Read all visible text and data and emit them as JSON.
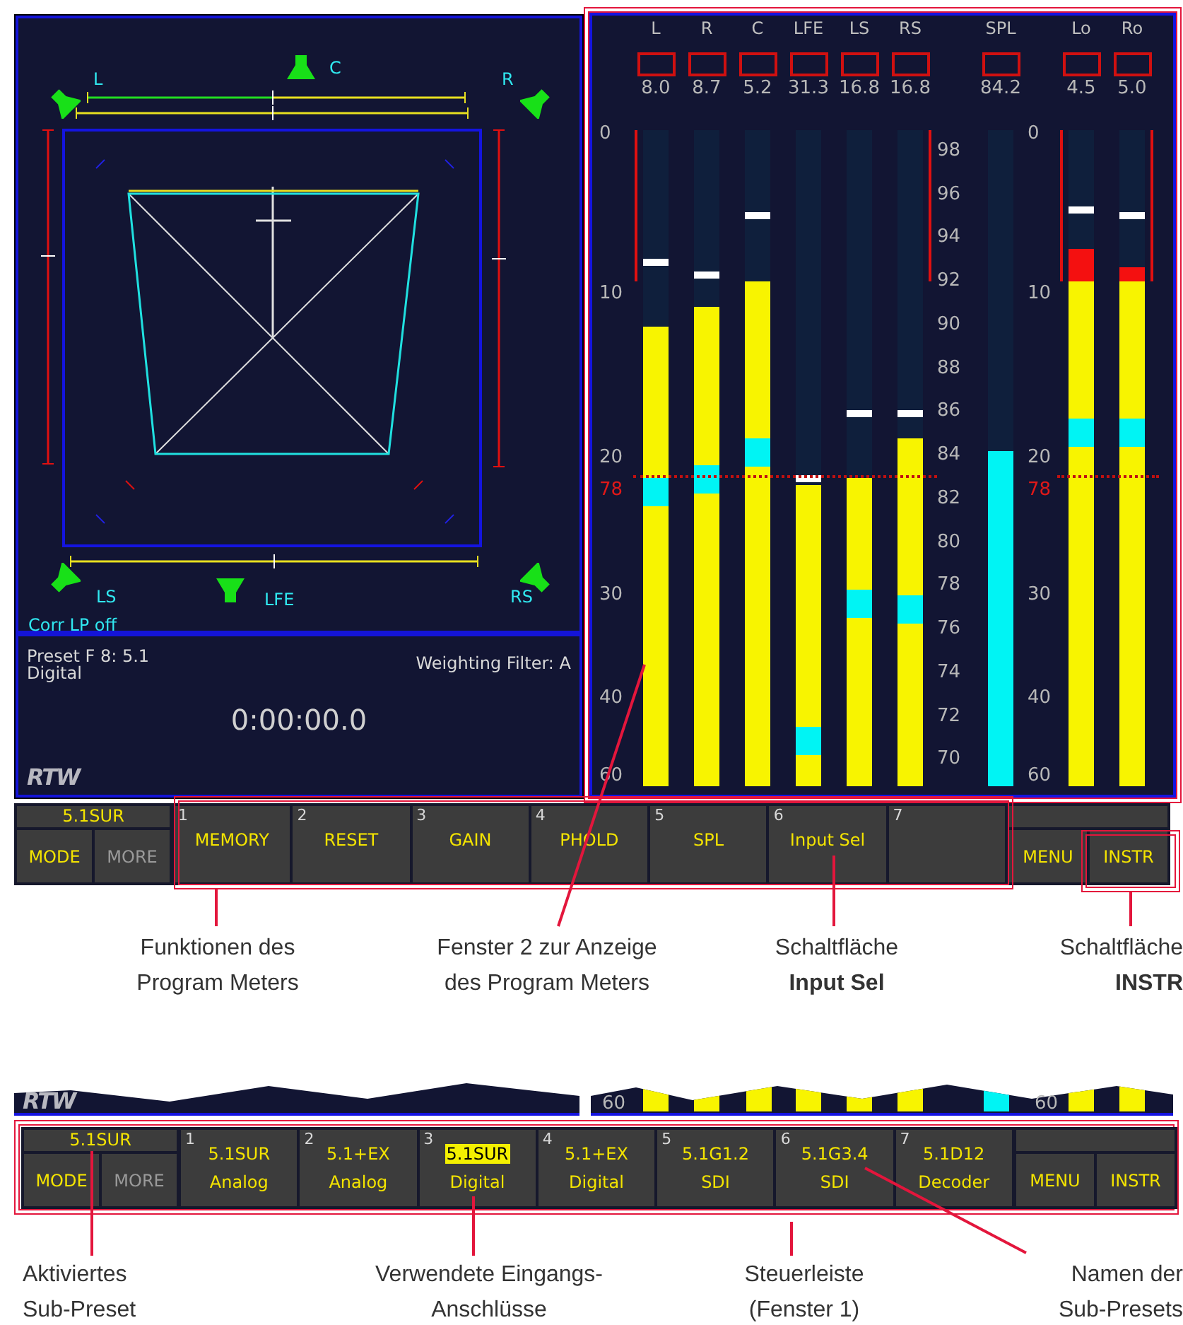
{
  "surround_display": {
    "speakers": [
      {
        "label": "L"
      },
      {
        "label": "C"
      },
      {
        "label": "R"
      },
      {
        "label": "LS"
      },
      {
        "label": "LFE"
      },
      {
        "label": "RS"
      }
    ],
    "status": "Corr LP off"
  },
  "info_panel": {
    "preset": "Preset F 8: 5.1",
    "input": "Digital",
    "weighting": "Weighting Filter: A",
    "timer": "0:00:00.0",
    "logo": "RTW"
  },
  "meters": {
    "left_scale": [
      {
        "label": "0",
        "kind": "tick"
      },
      {
        "label": "10",
        "kind": "tick"
      },
      {
        "label": "20",
        "kind": "tick"
      },
      {
        "label": "78",
        "kind": "ref"
      },
      {
        "label": "30",
        "kind": "tick"
      },
      {
        "label": "40",
        "kind": "tick"
      },
      {
        "label": "60",
        "kind": "tick"
      }
    ],
    "spl_scale": [
      {
        "label": "98"
      },
      {
        "label": "96"
      },
      {
        "label": "94"
      },
      {
        "label": "92"
      },
      {
        "label": "90"
      },
      {
        "label": "88"
      },
      {
        "label": "86"
      },
      {
        "label": "84"
      },
      {
        "label": "82"
      },
      {
        "label": "80"
      },
      {
        "label": "78"
      },
      {
        "label": "76"
      },
      {
        "label": "74"
      },
      {
        "label": "72"
      },
      {
        "label": "70"
      }
    ],
    "right_scale": [
      {
        "label": "0",
        "kind": "tick"
      },
      {
        "label": "10",
        "kind": "tick"
      },
      {
        "label": "20",
        "kind": "tick"
      },
      {
        "label": "78",
        "kind": "ref"
      },
      {
        "label": "30",
        "kind": "tick"
      },
      {
        "label": "40",
        "kind": "tick"
      },
      {
        "label": "60",
        "kind": "tick"
      }
    ],
    "channels": [
      {
        "kind": "channel",
        "label": "L",
        "reading": "8.0",
        "level": 0.7,
        "peak": {
          "level": 0.8
        },
        "marker": {
          "level": 0.47
        },
        "left_bracket": true
      },
      {
        "kind": "channel",
        "label": "R",
        "reading": "8.7",
        "level": 0.73,
        "peak": {
          "level": 0.78
        },
        "marker": {
          "level": 0.49
        }
      },
      {
        "kind": "channel",
        "label": "C",
        "reading": "5.2",
        "level": 0.77,
        "peak": {
          "level": 0.87
        },
        "marker": {
          "level": 0.53
        }
      },
      {
        "kind": "channel",
        "label": "LFE",
        "reading": "31.3",
        "level": 0.46,
        "peak": {
          "level": 0.47
        },
        "marker": {
          "level": 0.09
        }
      },
      {
        "kind": "channel",
        "label": "LS",
        "reading": "16.8",
        "level": 0.47,
        "peak": {
          "level": 0.57
        },
        "marker": {
          "level": 0.3
        }
      },
      {
        "kind": "channel",
        "label": "RS",
        "reading": "16.8",
        "level": 0.53,
        "peak": {
          "level": 0.57
        },
        "marker": {
          "level": 0.29
        },
        "right_bracket": true
      },
      {
        "kind": "spl",
        "label": "SPL",
        "reading": "84.2",
        "level": 0.51
      },
      {
        "kind": "channel",
        "label": "Lo",
        "reading": "4.5",
        "level": 0.77,
        "over": {
          "level": 0.82
        },
        "peak": {
          "level": 0.88
        },
        "marker": {
          "level": 0.56
        },
        "left_bracket": true
      },
      {
        "kind": "channel",
        "label": "Ro",
        "reading": "5.0",
        "level": 0.77,
        "over": {
          "level": 0.79
        },
        "peak": {
          "level": 0.87
        },
        "marker": {
          "level": 0.56
        },
        "right_bracket": true
      }
    ]
  },
  "control_bar": {
    "preset": "5.1SUR",
    "mode": {
      "label": "MODE",
      "disabled": false
    },
    "more": {
      "label": "MORE",
      "disabled": true
    },
    "functions": [
      {
        "number": "1",
        "label": "MEMORY"
      },
      {
        "number": "2",
        "label": "RESET"
      },
      {
        "number": "3",
        "label": "GAIN"
      },
      {
        "number": "4",
        "label": "PHOLD"
      },
      {
        "number": "5",
        "label": "SPL"
      },
      {
        "number": "6",
        "label": "Input Sel"
      },
      {
        "number": "7"
      }
    ],
    "menu": "MENU",
    "instr": "INSTR"
  },
  "callouts_top": [
    {
      "lines": [
        "Funktionen des",
        "Program Meters"
      ]
    },
    {
      "lines": [
        "Fenster 2 zur Anzeige",
        "des Program Meters"
      ]
    },
    {
      "lines": [
        "Schaltfläche",
        "**Input Sel**"
      ]
    },
    {
      "lines": [
        "Schaltfläche",
        "**INSTR**"
      ]
    }
  ],
  "strip": {
    "logo": "RTW",
    "scale_labels": [
      "60",
      "60"
    ]
  },
  "sub_preset_bar": {
    "preset": "5.1SUR",
    "mode": {
      "label": "MODE",
      "disabled": false
    },
    "more": {
      "label": "MORE",
      "disabled": true
    },
    "sub_presets": [
      {
        "number": "1",
        "name": "5.1SUR",
        "input": "Analog",
        "selected": false
      },
      {
        "number": "2",
        "name": "5.1+EX",
        "input": "Analog",
        "selected": false
      },
      {
        "number": "3",
        "name": "5.1SUR",
        "input": "Digital",
        "selected": true
      },
      {
        "number": "4",
        "name": "5.1+EX",
        "input": "Digital",
        "selected": false
      },
      {
        "number": "5",
        "name": "5.1G1.2",
        "input": "SDI",
        "selected": false
      },
      {
        "number": "6",
        "name": "5.1G3.4",
        "input": "SDI",
        "selected": false
      },
      {
        "number": "7",
        "name": "5.1D12",
        "input": "Decoder",
        "selected": false
      }
    ],
    "menu": "MENU",
    "instr": "INSTR"
  },
  "callouts_bottom": [
    {
      "lines": [
        "Aktiviertes",
        "Sub-Preset"
      ]
    },
    {
      "lines": [
        "Verwendete Eingangs-",
        "Anschlüsse"
      ]
    },
    {
      "lines": [
        "Steuerleiste",
        "(Fenster 1)"
      ]
    },
    {
      "lines": [
        "Namen der",
        "Sub-Presets"
      ]
    }
  ]
}
